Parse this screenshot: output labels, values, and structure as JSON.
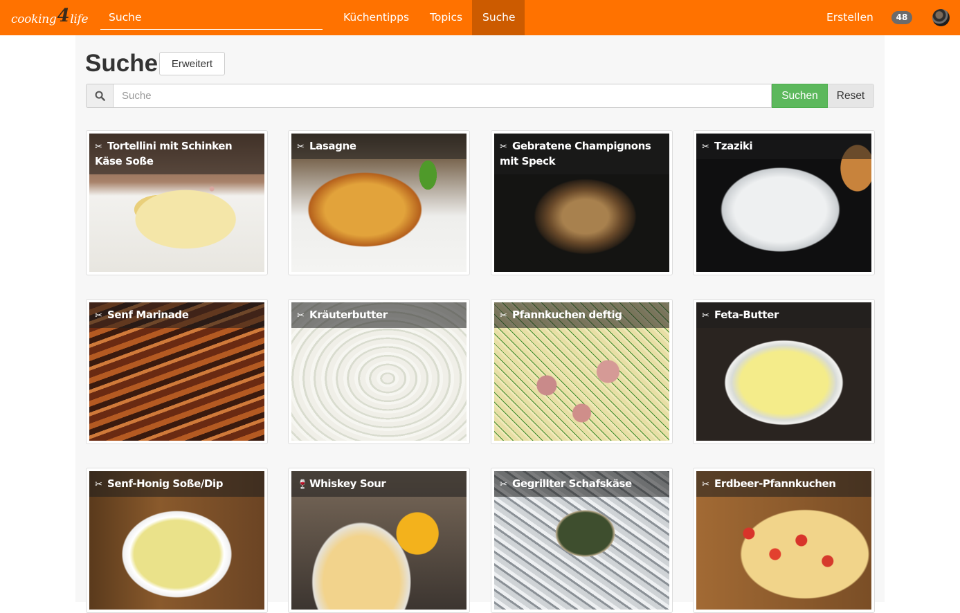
{
  "brand": {
    "pre": "cooking",
    "four": "4",
    "post": "life"
  },
  "nav": {
    "search_label": "Suche",
    "links": [
      "Küchentipps",
      "Topics",
      "Suche"
    ],
    "create": "Erstellen",
    "badge": "48"
  },
  "page": {
    "title": "Suche",
    "advanced_button": "Erweitert",
    "search_placeholder": "Suche",
    "search_button": "Suchen",
    "reset_button": "Reset"
  },
  "icons": {
    "recipe": "utensils-icon",
    "drink": "cocktail-icon",
    "search": "search-icon"
  },
  "recipes": [
    {
      "title": "Tortellini mit Schinken Käse Soße",
      "type": "recipe"
    },
    {
      "title": "Lasagne",
      "type": "recipe"
    },
    {
      "title": "Gebratene Champignons mit Speck",
      "type": "recipe"
    },
    {
      "title": "Tzaziki",
      "type": "recipe"
    },
    {
      "title": "Senf Marinade",
      "type": "recipe"
    },
    {
      "title": "Kräuterbutter",
      "type": "recipe"
    },
    {
      "title": "Pfannkuchen deftig",
      "type": "recipe"
    },
    {
      "title": "Feta-Butter",
      "type": "recipe"
    },
    {
      "title": "Senf-Honig Soße/Dip",
      "type": "recipe"
    },
    {
      "title": "Whiskey Sour",
      "type": "drink"
    },
    {
      "title": "Gegrillter Schafskäse",
      "type": "recipe"
    },
    {
      "title": "Erdbeer-Pfannkuchen",
      "type": "recipe"
    }
  ],
  "colors": {
    "navbar": "#ff7200",
    "nav_active": "#cc5b00",
    "search_button": "#5cb85c"
  }
}
